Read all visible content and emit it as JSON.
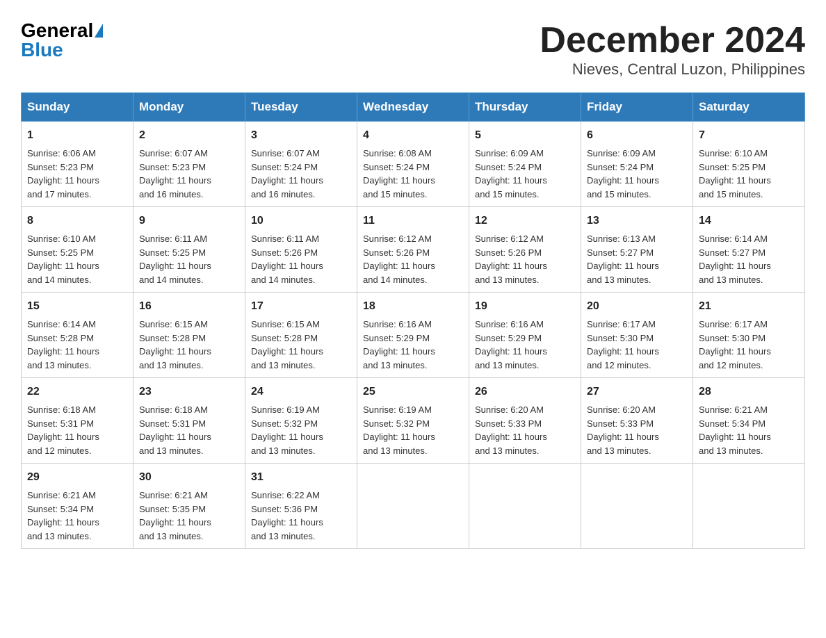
{
  "logo": {
    "general": "General",
    "blue": "Blue"
  },
  "title": "December 2024",
  "subtitle": "Nieves, Central Luzon, Philippines",
  "headers": [
    "Sunday",
    "Monday",
    "Tuesday",
    "Wednesday",
    "Thursday",
    "Friday",
    "Saturday"
  ],
  "weeks": [
    [
      {
        "day": "1",
        "sunrise": "6:06 AM",
        "sunset": "5:23 PM",
        "daylight": "11 hours and 17 minutes."
      },
      {
        "day": "2",
        "sunrise": "6:07 AM",
        "sunset": "5:23 PM",
        "daylight": "11 hours and 16 minutes."
      },
      {
        "day": "3",
        "sunrise": "6:07 AM",
        "sunset": "5:24 PM",
        "daylight": "11 hours and 16 minutes."
      },
      {
        "day": "4",
        "sunrise": "6:08 AM",
        "sunset": "5:24 PM",
        "daylight": "11 hours and 15 minutes."
      },
      {
        "day": "5",
        "sunrise": "6:09 AM",
        "sunset": "5:24 PM",
        "daylight": "11 hours and 15 minutes."
      },
      {
        "day": "6",
        "sunrise": "6:09 AM",
        "sunset": "5:24 PM",
        "daylight": "11 hours and 15 minutes."
      },
      {
        "day": "7",
        "sunrise": "6:10 AM",
        "sunset": "5:25 PM",
        "daylight": "11 hours and 15 minutes."
      }
    ],
    [
      {
        "day": "8",
        "sunrise": "6:10 AM",
        "sunset": "5:25 PM",
        "daylight": "11 hours and 14 minutes."
      },
      {
        "day": "9",
        "sunrise": "6:11 AM",
        "sunset": "5:25 PM",
        "daylight": "11 hours and 14 minutes."
      },
      {
        "day": "10",
        "sunrise": "6:11 AM",
        "sunset": "5:26 PM",
        "daylight": "11 hours and 14 minutes."
      },
      {
        "day": "11",
        "sunrise": "6:12 AM",
        "sunset": "5:26 PM",
        "daylight": "11 hours and 14 minutes."
      },
      {
        "day": "12",
        "sunrise": "6:12 AM",
        "sunset": "5:26 PM",
        "daylight": "11 hours and 13 minutes."
      },
      {
        "day": "13",
        "sunrise": "6:13 AM",
        "sunset": "5:27 PM",
        "daylight": "11 hours and 13 minutes."
      },
      {
        "day": "14",
        "sunrise": "6:14 AM",
        "sunset": "5:27 PM",
        "daylight": "11 hours and 13 minutes."
      }
    ],
    [
      {
        "day": "15",
        "sunrise": "6:14 AM",
        "sunset": "5:28 PM",
        "daylight": "11 hours and 13 minutes."
      },
      {
        "day": "16",
        "sunrise": "6:15 AM",
        "sunset": "5:28 PM",
        "daylight": "11 hours and 13 minutes."
      },
      {
        "day": "17",
        "sunrise": "6:15 AM",
        "sunset": "5:28 PM",
        "daylight": "11 hours and 13 minutes."
      },
      {
        "day": "18",
        "sunrise": "6:16 AM",
        "sunset": "5:29 PM",
        "daylight": "11 hours and 13 minutes."
      },
      {
        "day": "19",
        "sunrise": "6:16 AM",
        "sunset": "5:29 PM",
        "daylight": "11 hours and 13 minutes."
      },
      {
        "day": "20",
        "sunrise": "6:17 AM",
        "sunset": "5:30 PM",
        "daylight": "11 hours and 12 minutes."
      },
      {
        "day": "21",
        "sunrise": "6:17 AM",
        "sunset": "5:30 PM",
        "daylight": "11 hours and 12 minutes."
      }
    ],
    [
      {
        "day": "22",
        "sunrise": "6:18 AM",
        "sunset": "5:31 PM",
        "daylight": "11 hours and 12 minutes."
      },
      {
        "day": "23",
        "sunrise": "6:18 AM",
        "sunset": "5:31 PM",
        "daylight": "11 hours and 13 minutes."
      },
      {
        "day": "24",
        "sunrise": "6:19 AM",
        "sunset": "5:32 PM",
        "daylight": "11 hours and 13 minutes."
      },
      {
        "day": "25",
        "sunrise": "6:19 AM",
        "sunset": "5:32 PM",
        "daylight": "11 hours and 13 minutes."
      },
      {
        "day": "26",
        "sunrise": "6:20 AM",
        "sunset": "5:33 PM",
        "daylight": "11 hours and 13 minutes."
      },
      {
        "day": "27",
        "sunrise": "6:20 AM",
        "sunset": "5:33 PM",
        "daylight": "11 hours and 13 minutes."
      },
      {
        "day": "28",
        "sunrise": "6:21 AM",
        "sunset": "5:34 PM",
        "daylight": "11 hours and 13 minutes."
      }
    ],
    [
      {
        "day": "29",
        "sunrise": "6:21 AM",
        "sunset": "5:34 PM",
        "daylight": "11 hours and 13 minutes."
      },
      {
        "day": "30",
        "sunrise": "6:21 AM",
        "sunset": "5:35 PM",
        "daylight": "11 hours and 13 minutes."
      },
      {
        "day": "31",
        "sunrise": "6:22 AM",
        "sunset": "5:36 PM",
        "daylight": "11 hours and 13 minutes."
      },
      null,
      null,
      null,
      null
    ]
  ],
  "sunrise_label": "Sunrise:",
  "sunset_label": "Sunset:",
  "daylight_label": "Daylight:"
}
